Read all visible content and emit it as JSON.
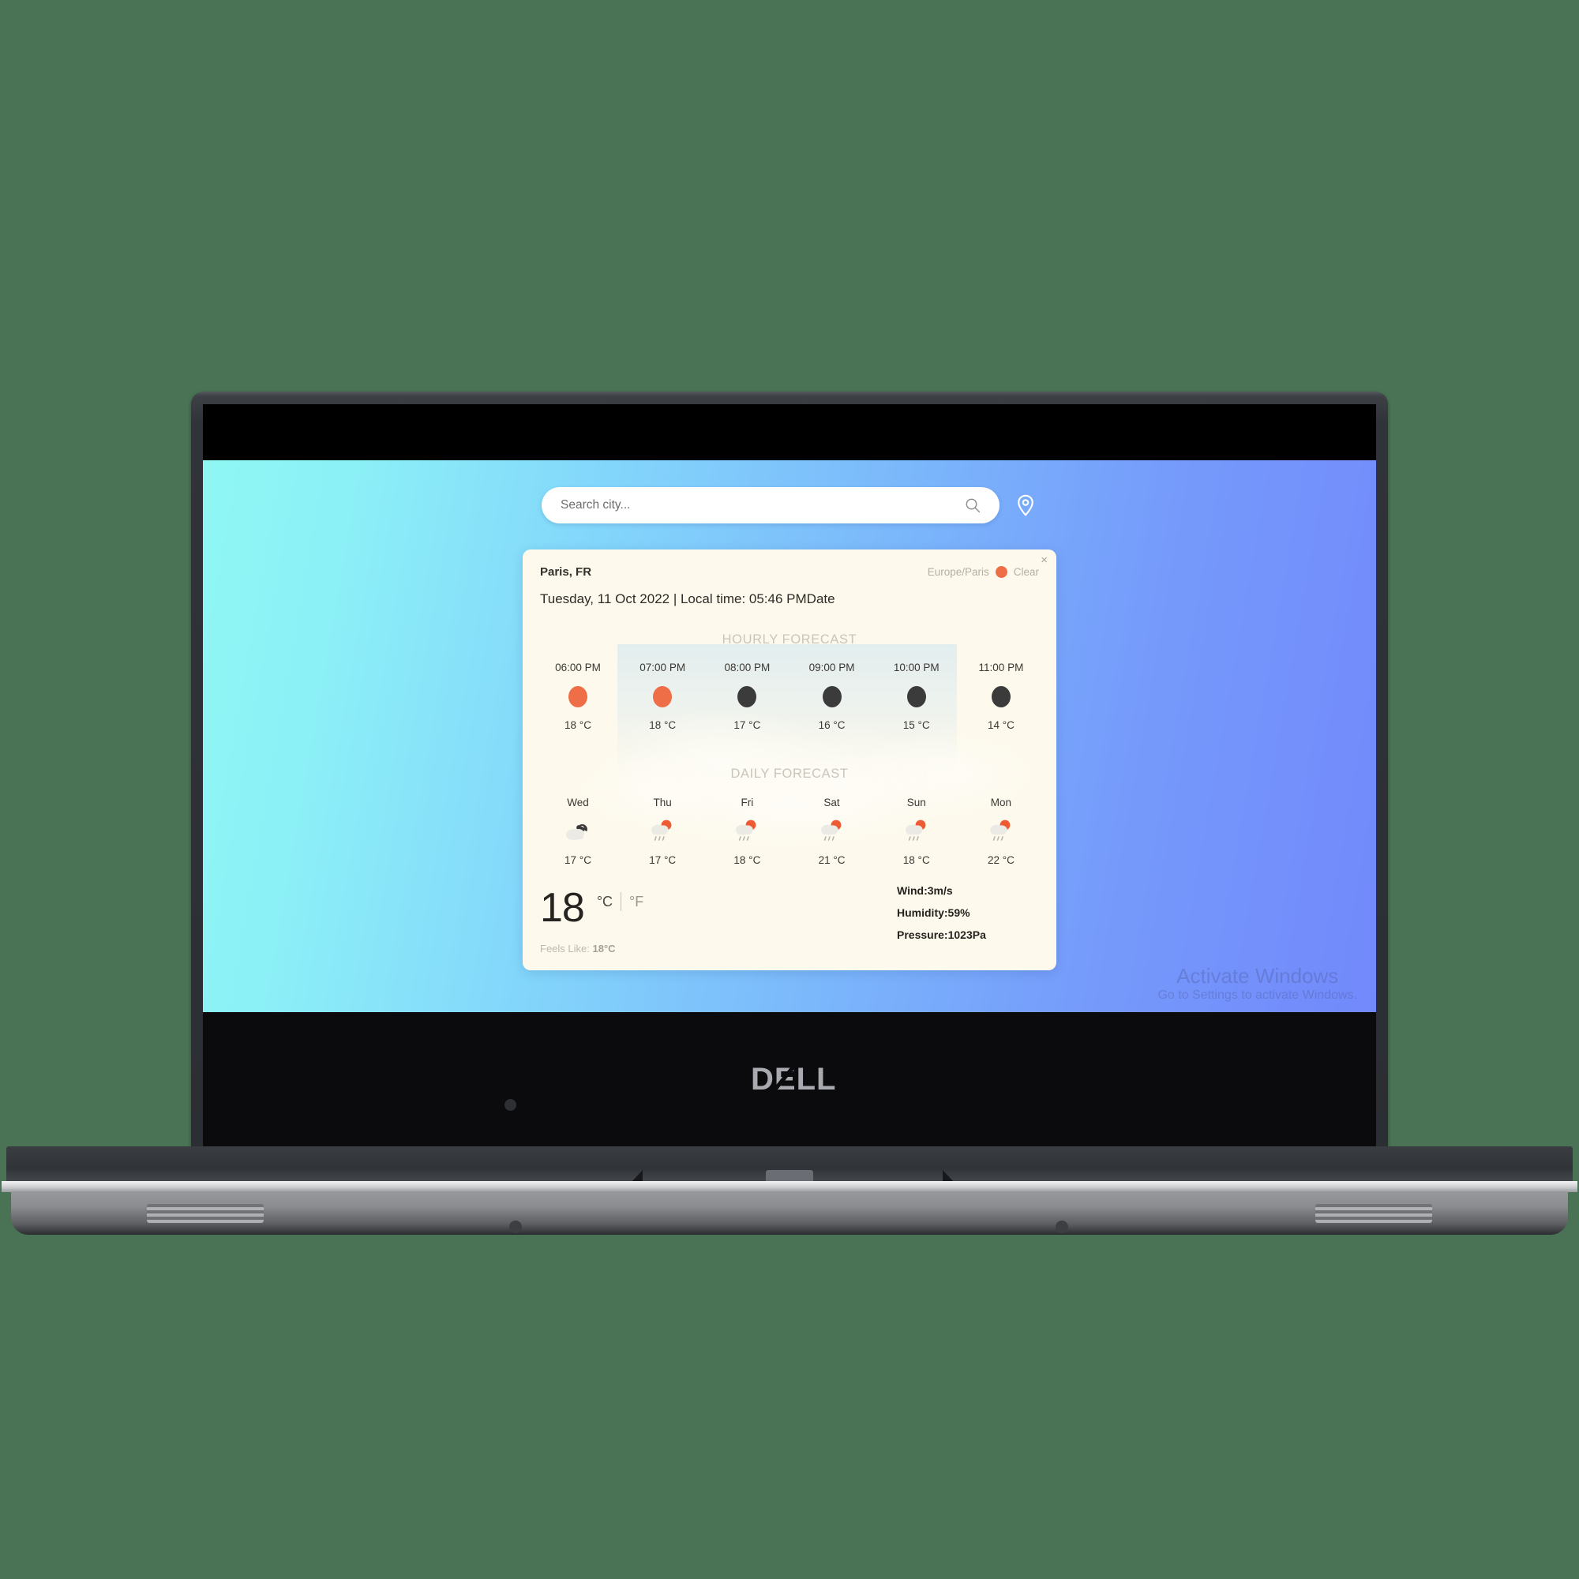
{
  "device": {
    "brand_logo": "DELL",
    "webcam_icon": "camera-dot"
  },
  "search": {
    "placeholder": "Search city...",
    "value": "",
    "search_icon": "search-icon",
    "location_icon": "location-pin-icon"
  },
  "card": {
    "city": "Paris, FR",
    "timezone": "Europe/Paris",
    "condition": "Clear",
    "condition_color": "#ee6f47",
    "close_label": "×",
    "date_line": "Tuesday, 11 Oct 2022 | Local time: 05:46 PMDate",
    "hourly_title": "HOURLY FORECAST",
    "daily_title": "DAILY FORECAST",
    "hourly": [
      {
        "label": "06:00 PM",
        "temp": "18 °C",
        "icon": "sun-circle-icon",
        "color": "#ee6f47"
      },
      {
        "label": "07:00 PM",
        "temp": "18 °C",
        "icon": "sun-circle-icon",
        "color": "#ee6f47"
      },
      {
        "label": "08:00 PM",
        "temp": "17 °C",
        "icon": "night-circle-icon",
        "color": "#3b3b3b"
      },
      {
        "label": "09:00 PM",
        "temp": "16 °C",
        "icon": "night-circle-icon",
        "color": "#3b3b3b"
      },
      {
        "label": "10:00 PM",
        "temp": "15 °C",
        "icon": "night-circle-icon",
        "color": "#3b3b3b"
      },
      {
        "label": "11:00 PM",
        "temp": "14 °C",
        "icon": "night-circle-icon",
        "color": "#3b3b3b"
      }
    ],
    "daily": [
      {
        "label": "Wed",
        "temp": "17 °C",
        "icon": "night-cloudy-icon"
      },
      {
        "label": "Thu",
        "temp": "17 °C",
        "icon": "sun-cloud-rain-icon"
      },
      {
        "label": "Fri",
        "temp": "18 °C",
        "icon": "sun-cloud-rain-icon"
      },
      {
        "label": "Sat",
        "temp": "21 °C",
        "icon": "sun-cloud-rain-icon"
      },
      {
        "label": "Sun",
        "temp": "18 °C",
        "icon": "sun-cloud-rain-icon"
      },
      {
        "label": "Mon",
        "temp": "22 °C",
        "icon": "sun-cloud-rain-icon"
      }
    ],
    "current": {
      "temperature": "18",
      "unit_celsius": "°C",
      "unit_fahrenheit": "°F",
      "feels_like_label": "Feels Like:",
      "feels_like_value": "18°C"
    },
    "stats": [
      "Wind:3m/s",
      "Humidity:59%",
      "Pressure:1023Pa"
    ]
  },
  "watermark": {
    "title": "Activate Windows",
    "subtitle": "Go to Settings to activate Windows."
  }
}
